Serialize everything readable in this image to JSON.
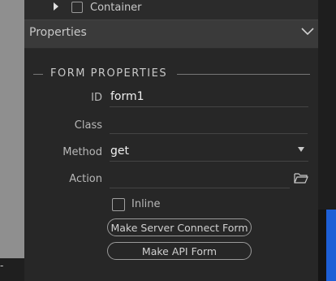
{
  "tree": {
    "item_label": "Container"
  },
  "properties_header": {
    "title": "Properties"
  },
  "section": {
    "title": "FORM PROPERTIES"
  },
  "fields": {
    "id": {
      "label": "ID",
      "value": "form1"
    },
    "class": {
      "label": "Class",
      "value": ""
    },
    "method": {
      "label": "Method",
      "value": "get"
    },
    "action": {
      "label": "Action",
      "value": ""
    }
  },
  "inline": {
    "label": "Inline",
    "checked": false
  },
  "buttons": {
    "server_connect": "Make Server Connect Form",
    "api_form": "Make API Form"
  },
  "left_panel": {
    "bottom_text": "-"
  },
  "colors": {
    "accent_blue": "#1d5fd6",
    "panel_bg": "#272727",
    "header_bg": "#3a3a3a"
  }
}
